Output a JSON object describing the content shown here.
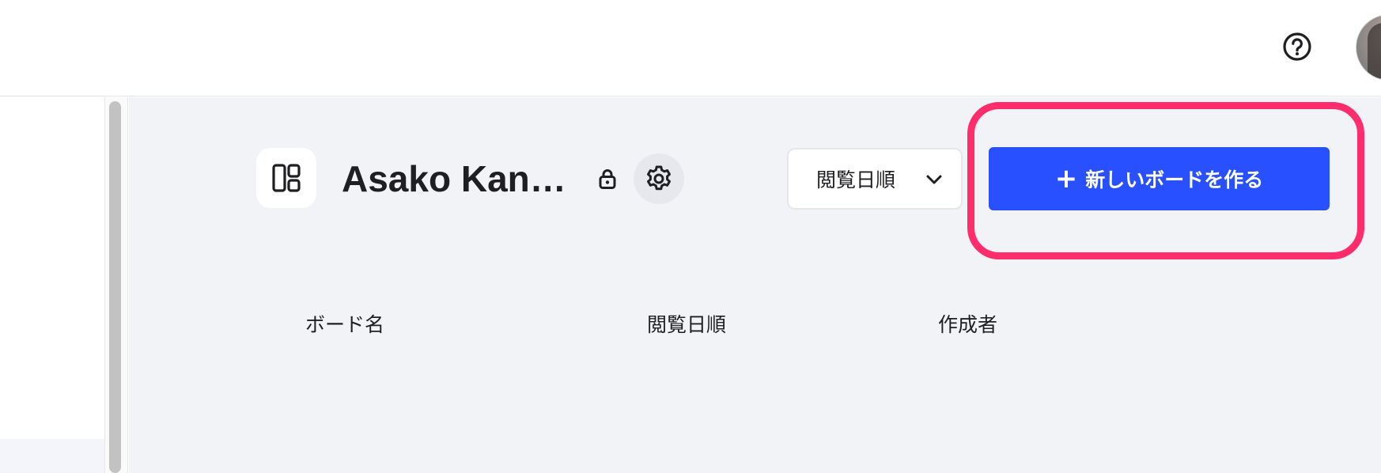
{
  "header": {
    "help_icon": "help-circle-icon",
    "avatar": "user-avatar"
  },
  "board": {
    "title": "Asako Kan…",
    "icon": "board-layout-icon",
    "lock_icon": "lock-icon",
    "settings_icon": "gear-icon"
  },
  "toolbar": {
    "sort_label": "閲覧日順",
    "create_label": "新しいボードを作る",
    "create_icon": "plus-icon",
    "accent_color": "#2950ff",
    "highlight_color": "#ff2d6b"
  },
  "table": {
    "columns": [
      "ボード名",
      "閲覧日順",
      "作成者"
    ]
  }
}
